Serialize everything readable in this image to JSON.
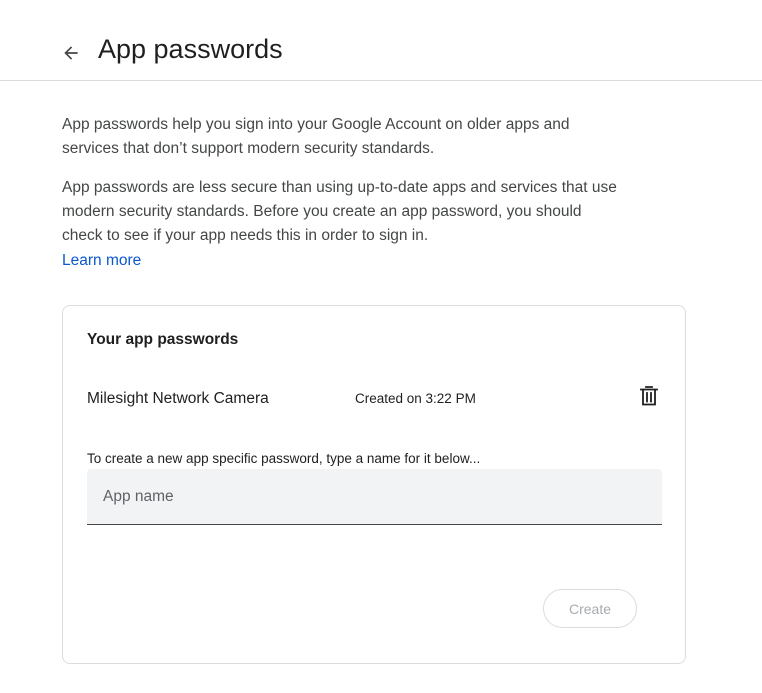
{
  "header": {
    "back_icon": "arrow-back-icon",
    "title": "App passwords"
  },
  "intro": {
    "paragraph1": "App passwords help you sign into your Google Account on older apps and services that don’t support modern security standards.",
    "paragraph2": "App passwords are less secure than using up-to-date apps and services that use modern security standards. Before you create an app password, you should check to see if your app needs this in order to sign in.",
    "learn_more": "Learn more"
  },
  "card": {
    "title": "Your app passwords",
    "passwords": [
      {
        "name": "Milesight Network Camera",
        "created": "Created on 3:22 PM",
        "delete_icon": "trash-icon"
      }
    ],
    "create_hint": "To create a new app specific password, type a name for it below...",
    "input": {
      "placeholder": "App name",
      "value": ""
    },
    "create_label": "Create"
  },
  "colors": {
    "link": "#0b57d0",
    "text_primary": "#1f1f1f",
    "text_secondary": "#444746",
    "border": "#dadce0",
    "input_bg": "#f1f3f4",
    "disabled_text": "#a8abaf"
  }
}
